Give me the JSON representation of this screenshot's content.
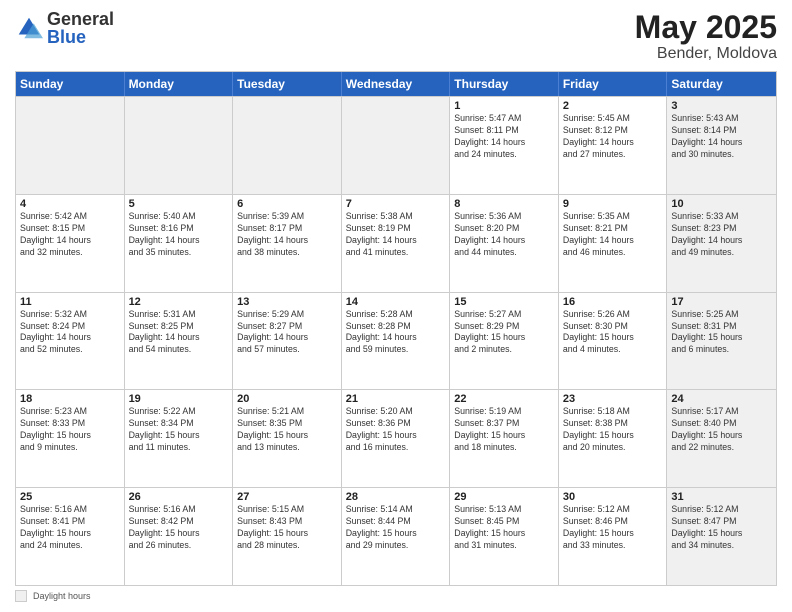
{
  "logo": {
    "general": "General",
    "blue": "Blue"
  },
  "title": "May 2025",
  "location": "Bender, Moldova",
  "days_of_week": [
    "Sunday",
    "Monday",
    "Tuesday",
    "Wednesday",
    "Thursday",
    "Friday",
    "Saturday"
  ],
  "weeks": [
    [
      {
        "day": "",
        "info": "",
        "shaded": true
      },
      {
        "day": "",
        "info": "",
        "shaded": true
      },
      {
        "day": "",
        "info": "",
        "shaded": true
      },
      {
        "day": "",
        "info": "",
        "shaded": true
      },
      {
        "day": "1",
        "info": "Sunrise: 5:47 AM\nSunset: 8:11 PM\nDaylight: 14 hours\nand 24 minutes.",
        "shaded": false
      },
      {
        "day": "2",
        "info": "Sunrise: 5:45 AM\nSunset: 8:12 PM\nDaylight: 14 hours\nand 27 minutes.",
        "shaded": false
      },
      {
        "day": "3",
        "info": "Sunrise: 5:43 AM\nSunset: 8:14 PM\nDaylight: 14 hours\nand 30 minutes.",
        "shaded": true
      }
    ],
    [
      {
        "day": "4",
        "info": "Sunrise: 5:42 AM\nSunset: 8:15 PM\nDaylight: 14 hours\nand 32 minutes.",
        "shaded": false
      },
      {
        "day": "5",
        "info": "Sunrise: 5:40 AM\nSunset: 8:16 PM\nDaylight: 14 hours\nand 35 minutes.",
        "shaded": false
      },
      {
        "day": "6",
        "info": "Sunrise: 5:39 AM\nSunset: 8:17 PM\nDaylight: 14 hours\nand 38 minutes.",
        "shaded": false
      },
      {
        "day": "7",
        "info": "Sunrise: 5:38 AM\nSunset: 8:19 PM\nDaylight: 14 hours\nand 41 minutes.",
        "shaded": false
      },
      {
        "day": "8",
        "info": "Sunrise: 5:36 AM\nSunset: 8:20 PM\nDaylight: 14 hours\nand 44 minutes.",
        "shaded": false
      },
      {
        "day": "9",
        "info": "Sunrise: 5:35 AM\nSunset: 8:21 PM\nDaylight: 14 hours\nand 46 minutes.",
        "shaded": false
      },
      {
        "day": "10",
        "info": "Sunrise: 5:33 AM\nSunset: 8:23 PM\nDaylight: 14 hours\nand 49 minutes.",
        "shaded": true
      }
    ],
    [
      {
        "day": "11",
        "info": "Sunrise: 5:32 AM\nSunset: 8:24 PM\nDaylight: 14 hours\nand 52 minutes.",
        "shaded": false
      },
      {
        "day": "12",
        "info": "Sunrise: 5:31 AM\nSunset: 8:25 PM\nDaylight: 14 hours\nand 54 minutes.",
        "shaded": false
      },
      {
        "day": "13",
        "info": "Sunrise: 5:29 AM\nSunset: 8:27 PM\nDaylight: 14 hours\nand 57 minutes.",
        "shaded": false
      },
      {
        "day": "14",
        "info": "Sunrise: 5:28 AM\nSunset: 8:28 PM\nDaylight: 14 hours\nand 59 minutes.",
        "shaded": false
      },
      {
        "day": "15",
        "info": "Sunrise: 5:27 AM\nSunset: 8:29 PM\nDaylight: 15 hours\nand 2 minutes.",
        "shaded": false
      },
      {
        "day": "16",
        "info": "Sunrise: 5:26 AM\nSunset: 8:30 PM\nDaylight: 15 hours\nand 4 minutes.",
        "shaded": false
      },
      {
        "day": "17",
        "info": "Sunrise: 5:25 AM\nSunset: 8:31 PM\nDaylight: 15 hours\nand 6 minutes.",
        "shaded": true
      }
    ],
    [
      {
        "day": "18",
        "info": "Sunrise: 5:23 AM\nSunset: 8:33 PM\nDaylight: 15 hours\nand 9 minutes.",
        "shaded": false
      },
      {
        "day": "19",
        "info": "Sunrise: 5:22 AM\nSunset: 8:34 PM\nDaylight: 15 hours\nand 11 minutes.",
        "shaded": false
      },
      {
        "day": "20",
        "info": "Sunrise: 5:21 AM\nSunset: 8:35 PM\nDaylight: 15 hours\nand 13 minutes.",
        "shaded": false
      },
      {
        "day": "21",
        "info": "Sunrise: 5:20 AM\nSunset: 8:36 PM\nDaylight: 15 hours\nand 16 minutes.",
        "shaded": false
      },
      {
        "day": "22",
        "info": "Sunrise: 5:19 AM\nSunset: 8:37 PM\nDaylight: 15 hours\nand 18 minutes.",
        "shaded": false
      },
      {
        "day": "23",
        "info": "Sunrise: 5:18 AM\nSunset: 8:38 PM\nDaylight: 15 hours\nand 20 minutes.",
        "shaded": false
      },
      {
        "day": "24",
        "info": "Sunrise: 5:17 AM\nSunset: 8:40 PM\nDaylight: 15 hours\nand 22 minutes.",
        "shaded": true
      }
    ],
    [
      {
        "day": "25",
        "info": "Sunrise: 5:16 AM\nSunset: 8:41 PM\nDaylight: 15 hours\nand 24 minutes.",
        "shaded": false
      },
      {
        "day": "26",
        "info": "Sunrise: 5:16 AM\nSunset: 8:42 PM\nDaylight: 15 hours\nand 26 minutes.",
        "shaded": false
      },
      {
        "day": "27",
        "info": "Sunrise: 5:15 AM\nSunset: 8:43 PM\nDaylight: 15 hours\nand 28 minutes.",
        "shaded": false
      },
      {
        "day": "28",
        "info": "Sunrise: 5:14 AM\nSunset: 8:44 PM\nDaylight: 15 hours\nand 29 minutes.",
        "shaded": false
      },
      {
        "day": "29",
        "info": "Sunrise: 5:13 AM\nSunset: 8:45 PM\nDaylight: 15 hours\nand 31 minutes.",
        "shaded": false
      },
      {
        "day": "30",
        "info": "Sunrise: 5:12 AM\nSunset: 8:46 PM\nDaylight: 15 hours\nand 33 minutes.",
        "shaded": false
      },
      {
        "day": "31",
        "info": "Sunrise: 5:12 AM\nSunset: 8:47 PM\nDaylight: 15 hours\nand 34 minutes.",
        "shaded": true
      }
    ]
  ],
  "footer": {
    "box_label": "Daylight hours"
  }
}
